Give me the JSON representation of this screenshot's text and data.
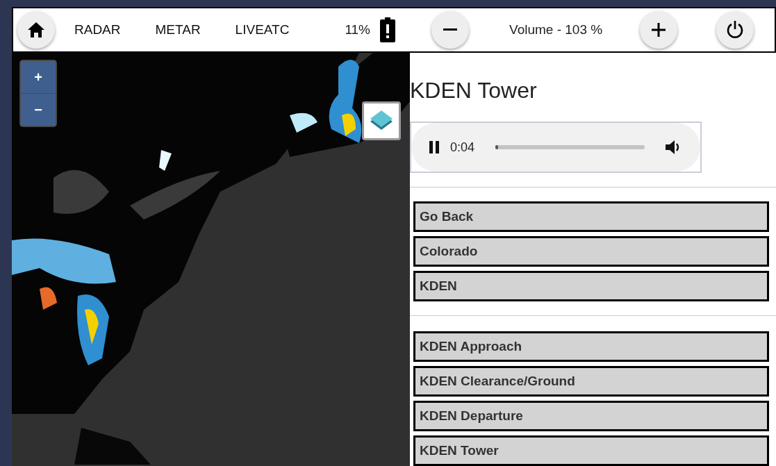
{
  "toolbar": {
    "nav": [
      "RADAR",
      "METAR",
      "LIVEATC"
    ],
    "battery": "11%",
    "volume": "Volume - 103 %"
  },
  "map": {
    "zoom_in": "+",
    "zoom_out": "−"
  },
  "panel": {
    "title": "KDEN Tower",
    "player": {
      "time": "0:04",
      "level": 0.02,
      "playing": true
    },
    "nav_buttons": [
      "Go Back",
      "Colorado",
      "KDEN"
    ],
    "feeds": [
      "KDEN Approach",
      "KDEN Clearance/Ground",
      "KDEN Departure",
      "KDEN Tower"
    ]
  }
}
